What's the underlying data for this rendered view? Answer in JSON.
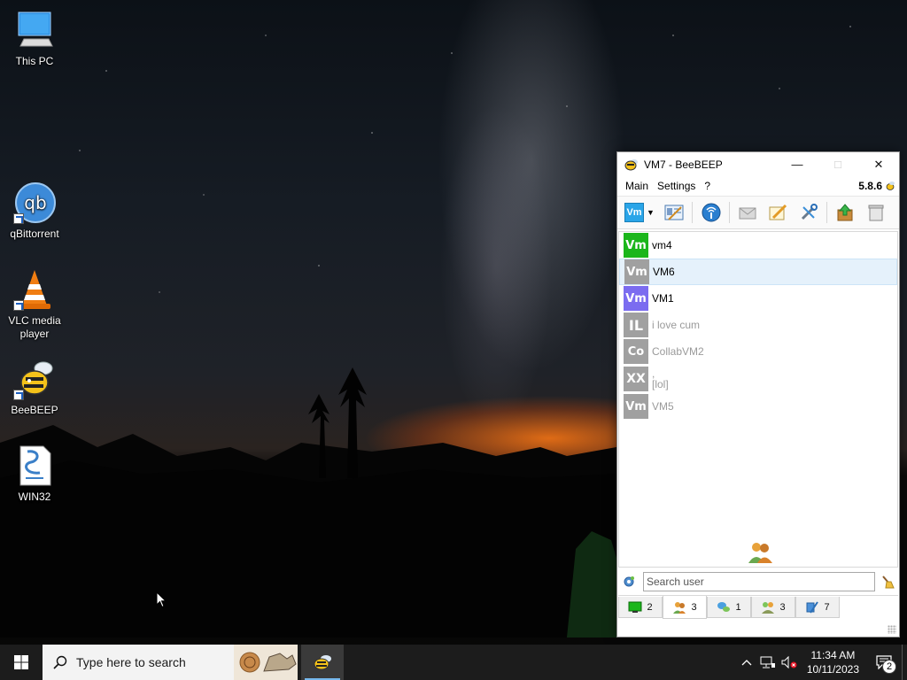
{
  "desktop": {
    "icons": [
      {
        "label": "This PC",
        "icon": "computer-icon"
      },
      {
        "label": "qBittorrent",
        "icon": "qbittorrent-icon"
      },
      {
        "label": "VLC media player",
        "icon": "vlc-icon"
      },
      {
        "label": "BeeBEEP",
        "icon": "bee-icon"
      },
      {
        "label": "WIN32",
        "icon": "script-icon"
      }
    ],
    "qb_glyph": "qb"
  },
  "window": {
    "title": "VM7 - BeeBEEP",
    "menu": [
      "Main",
      "Settings",
      "?"
    ],
    "version": "5.8.6",
    "toolbar_avatar": "Vm",
    "users": [
      {
        "initials": "Vm",
        "name": "vm4",
        "color": "#1bb61b",
        "online": true
      },
      {
        "initials": "Vm",
        "name": "VM6",
        "color": "#a0a0a0",
        "online": true,
        "selected": true
      },
      {
        "initials": "Vm",
        "name": "VM1",
        "color": "#7b6cf0",
        "online": true
      },
      {
        "initials": "IL",
        "name": "i love cum",
        "color": "#a0a0a0",
        "online": false
      },
      {
        "initials": "Co",
        "name": "CollabVM2",
        "color": "#a0a0a0",
        "online": false
      },
      {
        "initials": "XX",
        "name_line1": ",",
        "name_line2": "[lol]",
        "color": "#a0a0a0",
        "online": false
      },
      {
        "initials": "Vm",
        "name": "VM5",
        "color": "#a0a0a0",
        "online": false
      }
    ],
    "search_placeholder": "Search user",
    "tabs": [
      {
        "icon": "monitor-icon",
        "count": "2"
      },
      {
        "icon": "users-icon",
        "count": "3",
        "active": true
      },
      {
        "icon": "chat-icon",
        "count": "1"
      },
      {
        "icon": "groups-icon",
        "count": "3"
      },
      {
        "icon": "files-icon",
        "count": "7"
      }
    ]
  },
  "taskbar": {
    "search_placeholder": "Type here to search",
    "time": "11:34 AM",
    "date": "10/11/2023",
    "notifications": "2"
  }
}
